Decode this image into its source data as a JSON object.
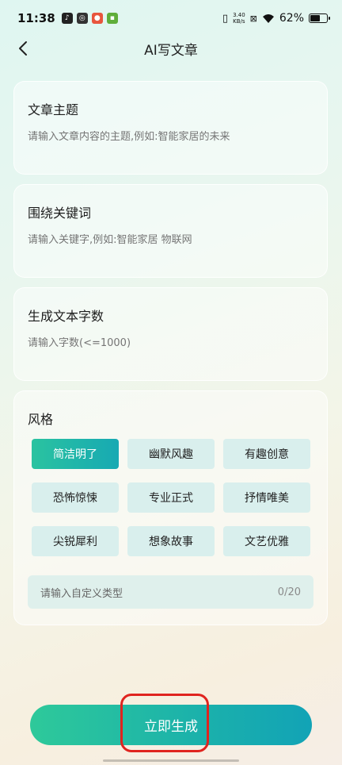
{
  "status_bar": {
    "time": "11:38",
    "net_speed_value": "3.40",
    "net_speed_unit": "KB/s",
    "battery_percent": "62%",
    "battery_level": 0.62
  },
  "header": {
    "title": "AI写文章",
    "back_icon": "chevron-left-icon"
  },
  "topic": {
    "title": "文章主题",
    "placeholder": "请输入文章内容的主题,例如:智能家居的未来"
  },
  "keywords": {
    "title": "围绕关键词",
    "placeholder": "请输入关键字,例如:智能家居 物联网"
  },
  "word_count": {
    "title": "生成文本字数",
    "placeholder": "请输入字数(<=1000)"
  },
  "style": {
    "title": "风格",
    "options": [
      "简洁明了",
      "幽默风趣",
      "有趣创意",
      "恐怖惊悚",
      "专业正式",
      "抒情唯美",
      "尖锐犀利",
      "想象故事",
      "文艺优雅"
    ],
    "selected": "简洁明了",
    "custom_placeholder": "请输入自定义类型",
    "custom_counter": "0/20"
  },
  "generate_button": {
    "label": "立即生成"
  },
  "colors": {
    "accent_start": "#2ec99a",
    "accent_end": "#12a3b6",
    "highlight": "#e0241f"
  }
}
